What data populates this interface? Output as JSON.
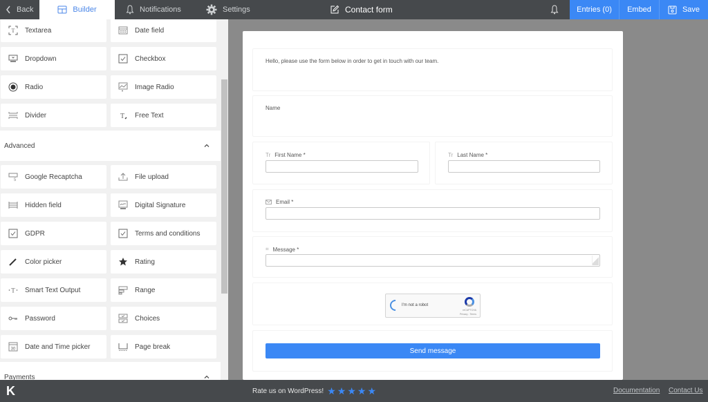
{
  "topbar": {
    "back_label": "Back",
    "builder_label": "Builder",
    "notifications_label": "Notifications",
    "settings_label": "Settings",
    "form_title": "Contact form",
    "entries_label": "Entries (0)",
    "embed_label": "Embed",
    "save_label": "Save"
  },
  "sidebar": {
    "basic_items": [
      {
        "label": "Textarea",
        "icon": "textarea-icon"
      },
      {
        "label": "Date field",
        "icon": "calendar-icon"
      },
      {
        "label": "Dropdown",
        "icon": "dropdown-icon"
      },
      {
        "label": "Checkbox",
        "icon": "checkbox-icon"
      },
      {
        "label": "Radio",
        "icon": "radio-icon"
      },
      {
        "label": "Image Radio",
        "icon": "image-radio-icon"
      },
      {
        "label": "Divider",
        "icon": "divider-icon"
      },
      {
        "label": "Free Text",
        "icon": "free-text-icon"
      }
    ],
    "advanced_title": "Advanced",
    "advanced_items": [
      {
        "label": "Google Recaptcha",
        "icon": "recaptcha-icon"
      },
      {
        "label": "File upload",
        "icon": "upload-icon"
      },
      {
        "label": "Hidden field",
        "icon": "hidden-field-icon"
      },
      {
        "label": "Digital Signature",
        "icon": "signature-icon"
      },
      {
        "label": "GDPR",
        "icon": "checkbox-icon"
      },
      {
        "label": "Terms and conditions",
        "icon": "checkbox-icon"
      },
      {
        "label": "Color picker",
        "icon": "pencil-icon"
      },
      {
        "label": "Rating",
        "icon": "star-icon"
      },
      {
        "label": "Smart Text Output",
        "icon": "smart-text-icon"
      },
      {
        "label": "Range",
        "icon": "range-icon"
      },
      {
        "label": "Password",
        "icon": "key-icon"
      },
      {
        "label": "Choices",
        "icon": "choices-icon"
      },
      {
        "label": "Date and Time picker",
        "icon": "datetime-icon"
      },
      {
        "label": "Page break",
        "icon": "page-break-icon"
      }
    ],
    "payments_title": "Payments"
  },
  "form": {
    "intro_text": "Hello, please use the form below in order to get in touch with our team.",
    "name_heading": "Name",
    "first_name_label": "First Name *",
    "last_name_label": "Last Name *",
    "email_label": "Email *",
    "message_label": "Message *",
    "first_name_value": "",
    "last_name_value": "",
    "email_value": "",
    "message_value": "",
    "recaptcha": {
      "text": "I'm not a robot",
      "brand": "reCAPTCHA",
      "links": "Privacy - Terms"
    },
    "submit_label": "Send message"
  },
  "footer": {
    "logo": "K",
    "rate_text": "Rate us on WordPress!",
    "star_count": 5,
    "documentation_label": "Documentation",
    "contact_label": "Contact Us"
  },
  "colors": {
    "accent": "#3b88f5",
    "topbar_bg": "#46494c",
    "canvas_bg": "#8a8a8a"
  }
}
